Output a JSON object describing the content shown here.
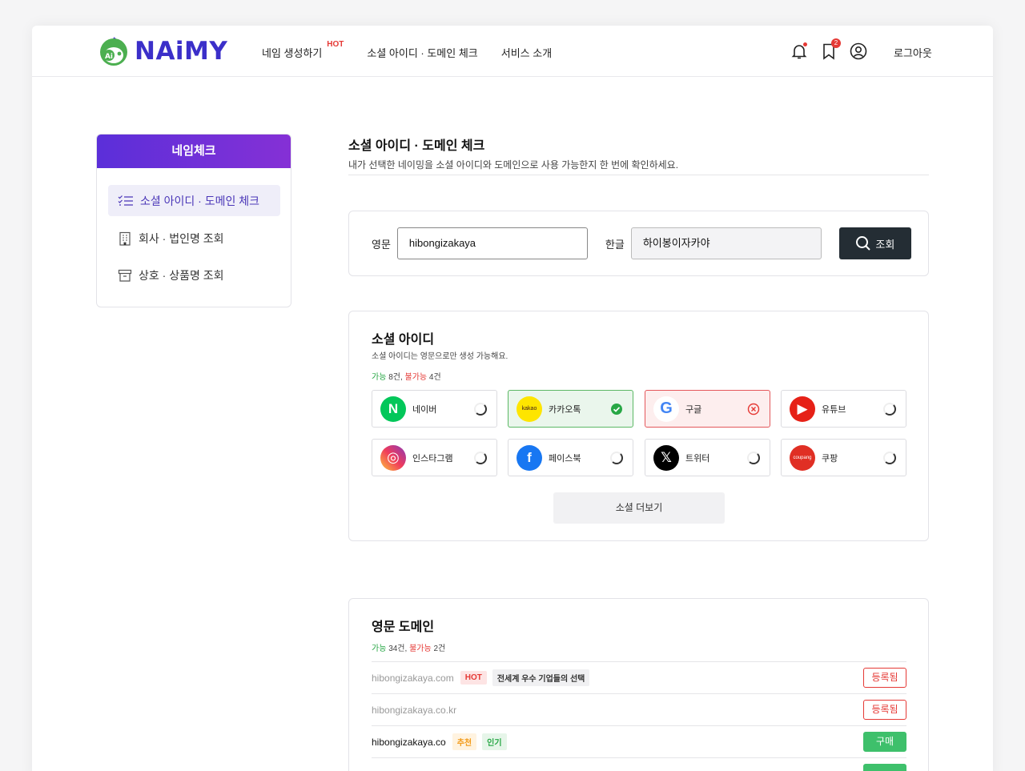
{
  "brand": {
    "name": "NAiMY",
    "mark_text": "Ai"
  },
  "nav": {
    "items": [
      {
        "label": "네임 생성하기",
        "badge": "HOT"
      },
      {
        "label": "소셜 아이디 · 도메인 체크"
      },
      {
        "label": "서비스 소개"
      }
    ],
    "bookmark_count": "2",
    "logout": "로그아웃"
  },
  "sidebar": {
    "title": "네임체크",
    "items": [
      {
        "label": "소셜 아이디 · 도메인 체크",
        "icon": "checklist-icon",
        "active": true
      },
      {
        "label": "회사 · 법인명 조회",
        "icon": "building-icon"
      },
      {
        "label": "상호 · 상품명 조회",
        "icon": "archive-icon"
      }
    ]
  },
  "main": {
    "title": "소셜 아이디 · 도메인 체크",
    "subtitle": "내가 선택한 네이밍을 소셜 아이디와 도메인으로 사용 가능한지 한 번에 확인하세요."
  },
  "search": {
    "en_label": "영문",
    "en_value": "hibongizakaya",
    "ko_label": "한글",
    "ko_value": "하이봉이자카야",
    "button": "조회"
  },
  "social": {
    "title": "소셜 아이디",
    "subtitle": "소셜 아이디는 영문으로만 생성 가능해요.",
    "available_label": "가능",
    "available_count": "8건",
    "unavailable_label": "불가능",
    "unavailable_count": "4건",
    "tiles": [
      {
        "name": "네이버",
        "status": "loading",
        "color": "#03c75a",
        "icon": "naver-icon",
        "glyph": "N"
      },
      {
        "name": "카카오톡",
        "status": "available",
        "color": "#fee500",
        "icon": "kakao-icon",
        "glyph": "kakao"
      },
      {
        "name": "구글",
        "status": "unavailable",
        "color": "#ffffff",
        "icon": "google-icon",
        "glyph": "G"
      },
      {
        "name": "유튜브",
        "status": "loading",
        "color": "#e62117",
        "icon": "youtube-icon",
        "glyph": "▶"
      },
      {
        "name": "인스타그램",
        "status": "loading",
        "color": "#d6249f",
        "icon": "instagram-icon",
        "glyph": "◎"
      },
      {
        "name": "페이스북",
        "status": "loading",
        "color": "#1877f2",
        "icon": "facebook-icon",
        "glyph": "f"
      },
      {
        "name": "트위터",
        "status": "loading",
        "color": "#000000",
        "icon": "x-twitter-icon",
        "glyph": "𝕏"
      },
      {
        "name": "쿠팡",
        "status": "loading",
        "color": "#e02f24",
        "icon": "coupang-icon",
        "glyph": "coupang"
      }
    ],
    "more": "소셜 더보기"
  },
  "domain": {
    "title": "영문 도메인",
    "available_label": "가능",
    "available_count": "34건",
    "unavailable_label": "불가능",
    "unavailable_count": "2건",
    "rows": [
      {
        "name": "hibongizakaya.com",
        "tags": [
          {
            "text": "HOT",
            "kind": "hot"
          },
          {
            "text": "전세계 우수 기업들의 선택",
            "kind": "gray"
          }
        ],
        "action": "등록됨",
        "action_kind": "reg",
        "available": false
      },
      {
        "name": "hibongizakaya.co.kr",
        "tags": [],
        "action": "등록됨",
        "action_kind": "reg",
        "available": false
      },
      {
        "name": "hibongizakaya.co",
        "tags": [
          {
            "text": "추천",
            "kind": "rec"
          },
          {
            "text": "인기",
            "kind": "pop"
          }
        ],
        "action": "구매",
        "action_kind": "buy",
        "available": true
      },
      {
        "name": "",
        "tags": [],
        "action": "",
        "action_kind": "buy",
        "available": true
      }
    ]
  }
}
